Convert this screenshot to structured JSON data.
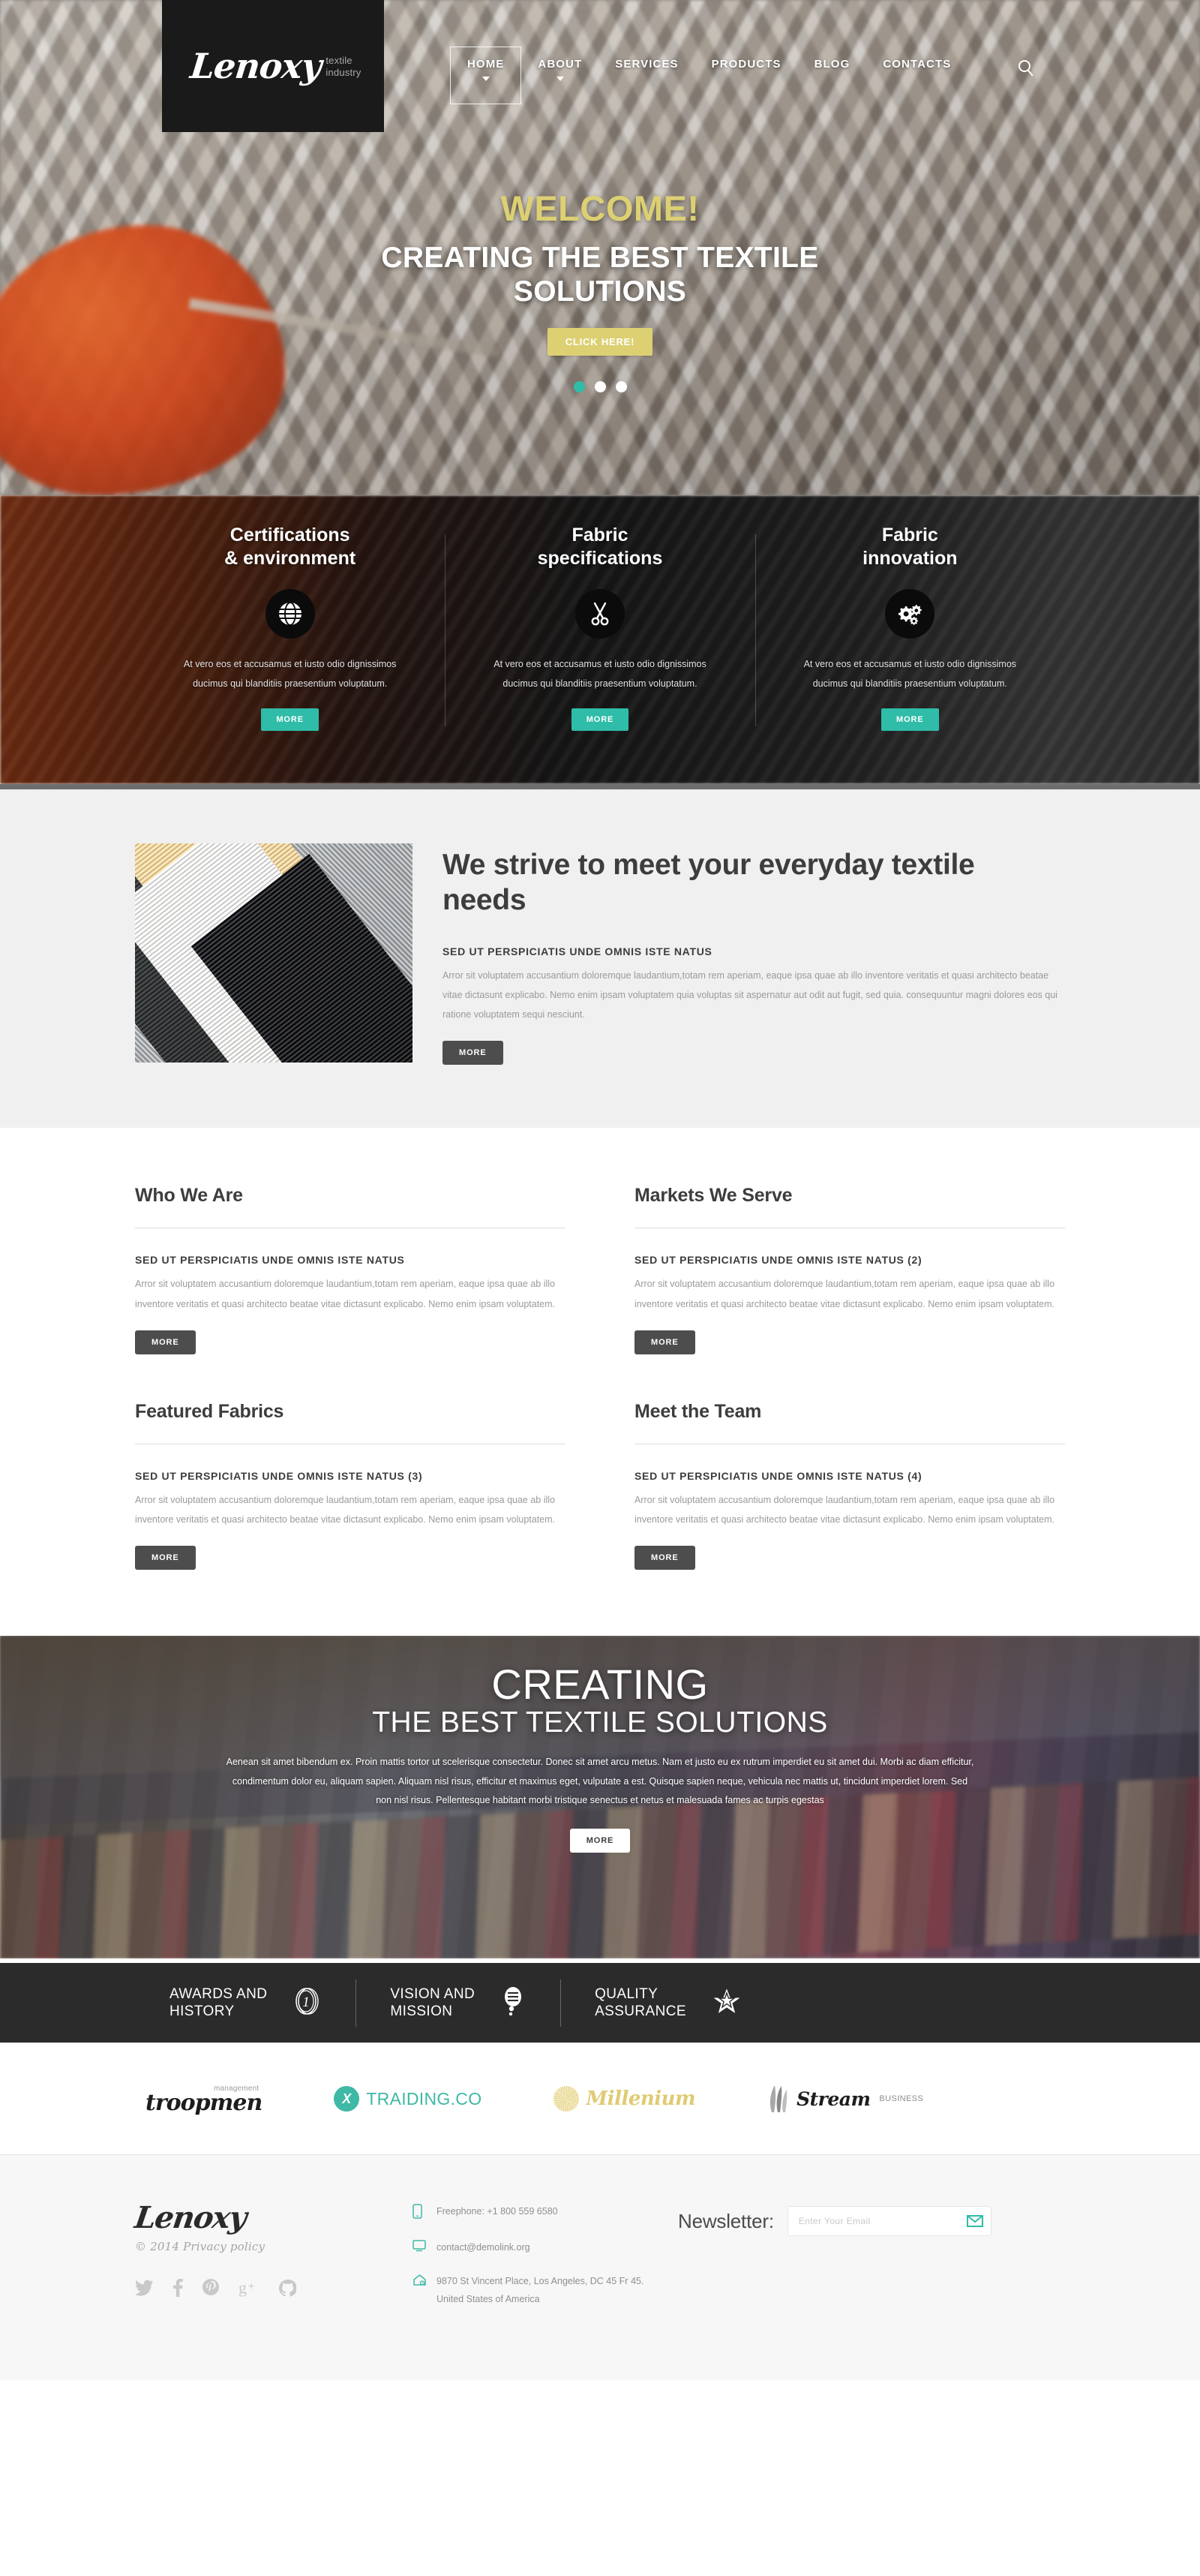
{
  "brand": {
    "name": "Lenoxy",
    "tagline_line1": "textile",
    "tagline_line2": "industry"
  },
  "nav": {
    "items": [
      {
        "label": "HOME",
        "active": true,
        "caret": true
      },
      {
        "label": "ABOUT",
        "active": false,
        "caret": true
      },
      {
        "label": "SERVICES",
        "active": false,
        "caret": false
      },
      {
        "label": "PRODUCTS",
        "active": false,
        "caret": false
      },
      {
        "label": "BLOG",
        "active": false,
        "caret": false
      },
      {
        "label": "CONTACTS",
        "active": false,
        "caret": false
      }
    ],
    "search_icon": "search-icon"
  },
  "hero": {
    "welcome": "WELCOME!",
    "title": "CREATING THE BEST TEXTILE SOLUTIONS",
    "cta": "CLICK HERE!",
    "slides": 3,
    "active_slide": 1,
    "accent_gold": "#ddd073",
    "accent_teal": "#2fbca8"
  },
  "features": {
    "body": "At vero eos et accusamus et iusto odio dignissimos ducimus qui blanditiis praesentium voluptatum.",
    "more_label": "MORE",
    "cards": [
      {
        "title_line1": "Certifications",
        "title_line2": "& environment",
        "icon": "globe-icon"
      },
      {
        "title_line1": "Fabric",
        "title_line2": "specifications",
        "icon": "scissors-icon"
      },
      {
        "title_line1": "Fabric",
        "title_line2": "innovation",
        "icon": "gears-icon"
      }
    ]
  },
  "strive": {
    "heading": "We strive to meet your everyday textile needs",
    "subheading": "SED UT PERSPICIATIS UNDE OMNIS ISTE NATUS",
    "paragraph": "Arror sit voluptatem accusantium doloremque laudantium,totam rem aperiam, eaque ipsa quae ab illo inventore veritatis et quasi architecto beatae vitae dictasunt explicabo. Nemo enim ipsam voluptatem quia voluptas sit aspernatur aut odit aut fugit, sed quia. consequuntur magni dolores eos qui ratione voluptatem sequi nesciunt.",
    "more_label": "MORE",
    "image_alt": "fabric-swatches-photo"
  },
  "quad": {
    "more_label": "MORE",
    "blocks": [
      {
        "heading": "Who We Are",
        "subheading": "SED UT PERSPICIATIS UNDE OMNIS ISTE NATUS",
        "paragraph": "Arror sit voluptatem accusantium doloremque laudantium,totam rem aperiam, eaque ipsa quae ab illo inventore veritatis et quasi architecto beatae vitae dictasunt explicabo. Nemo enim ipsam voluptatem."
      },
      {
        "heading": "Markets We Serve",
        "subheading": "SED UT PERSPICIATIS UNDE OMNIS ISTE NATUS (2)",
        "paragraph": "Arror sit voluptatem accusantium doloremque laudantium,totam rem aperiam, eaque ipsa quae ab illo inventore veritatis et quasi architecto beatae vitae dictasunt explicabo. Nemo enim ipsam voluptatem."
      },
      {
        "heading": "Featured Fabrics",
        "subheading": "SED UT PERSPICIATIS UNDE OMNIS ISTE NATUS (3)",
        "paragraph": "Arror sit voluptatem accusantium doloremque laudantium,totam rem aperiam, eaque ipsa quae ab illo inventore veritatis et quasi architecto beatae vitae dictasunt explicabo. Nemo enim ipsam voluptatem."
      },
      {
        "heading": "Meet the Team",
        "subheading": "SED UT PERSPICIATIS UNDE OMNIS ISTE NATUS (4)",
        "paragraph": "Arror sit voluptatem accusantium doloremque laudantium,totam rem aperiam, eaque ipsa quae ab illo inventore veritatis et quasi architecto beatae vitae dictasunt explicabo. Nemo enim ipsam voluptatem."
      }
    ]
  },
  "parallax": {
    "heading_main": "CREATING",
    "heading_sub": "THE BEST TEXTILE SOLUTIONS",
    "paragraph": "Aenean sit amet bibendum ex. Proin mattis tortor ut scelerisque consectetur. Donec sit amet arcu metus. Nam et justo eu ex rutrum imperdiet eu sit amet dui. Morbi ac diam efficitur, condimentum dolor eu, aliquam sapien. Aliquam nisl risus, efficitur et maximus eget, vulputate a est. Quisque sapien neque, vehicula nec mattis ut, tincidunt imperdiet lorem. Sed non nisl risus. Pellentesque habitant morbi tristique senectus et netus et malesuada fames ac turpis egestas",
    "more_label": "MORE"
  },
  "stats": {
    "items": [
      {
        "line1": "AWARDS AND",
        "line2": "HISTORY",
        "icon": "medal-number-one-icon"
      },
      {
        "line1": "VISION AND",
        "line2": "MISSION",
        "icon": "speech-bubble-icon"
      },
      {
        "line1": "QUALITY",
        "line2": "ASSURANCE",
        "icon": "star-icon"
      }
    ]
  },
  "partners": [
    {
      "name": "troopmen",
      "sup": "management",
      "icon": "none"
    },
    {
      "name": "TRAIDING.CO",
      "icon": "x-circle-icon"
    },
    {
      "name": "Millenium",
      "icon": "sunburst-icon"
    },
    {
      "name": "Stream",
      "sub": "BUSINESS",
      "icon": "leaf-icon"
    }
  ],
  "footer": {
    "logo": "Lenoxy",
    "copyright": "© 2014 Privacy policy",
    "socials": [
      {
        "name": "twitter-icon"
      },
      {
        "name": "facebook-icon"
      },
      {
        "name": "pinterest-icon"
      },
      {
        "name": "google-plus-icon"
      },
      {
        "name": "github-icon"
      }
    ],
    "contacts": [
      {
        "icon": "phone-icon",
        "text": "Freephone: +1 800 559 6580"
      },
      {
        "icon": "monitor-icon",
        "text": "contact@demolink.org"
      },
      {
        "icon": "home-icon",
        "text": "9870 St Vincent Place, Los Angeles, DC 45 Fr 45. United States of America"
      }
    ],
    "newsletter": {
      "label": "Newsletter:",
      "placeholder": "Enter Your Email",
      "value": "",
      "submit_icon": "envelope-icon"
    }
  }
}
